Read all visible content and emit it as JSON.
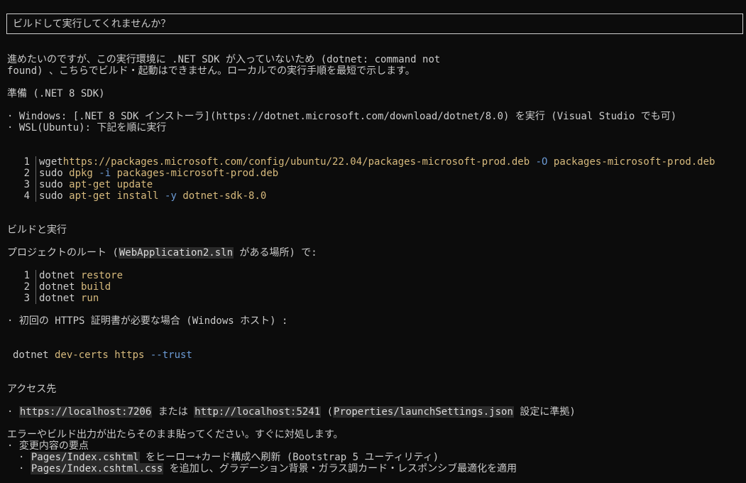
{
  "prompt": "ビルドして実行してくれませんか？",
  "intro": {
    "line1": "進めたいのですが、この実行環境に .NET SDK が入っていないため (dotnet: command not",
    "line2": "found) 、こちらでビルド・起動はできません。ローカルでの実行手順を最短で示します。"
  },
  "prep": {
    "heading": "準備 (.NET 8 SDK)",
    "bullet_windows": "Windows: [.NET 8 SDK インストーラ](https://dotnet.microsoft.com/download/dotnet/8.0) を実行 (Visual Studio でも可)",
    "bullet_wsl": "WSL(Ubuntu): 下記を順に実行",
    "code": [
      {
        "n": "1",
        "cmd": "wget",
        "args": [
          {
            "t": "https://packages.microsoft.com/config/ubuntu/22.04/packages-microsoft-prod.deb",
            "c": "arg"
          },
          {
            "t": " -O",
            "c": "flag"
          },
          {
            "t": " packages-microsoft-prod.deb",
            "c": "arg"
          }
        ]
      },
      {
        "n": "2",
        "cmd": "sudo",
        "args": [
          {
            "t": " dpkg",
            "c": "arg"
          },
          {
            "t": " -i",
            "c": "flag"
          },
          {
            "t": " packages-microsoft-prod.deb",
            "c": "arg"
          }
        ]
      },
      {
        "n": "3",
        "cmd": "sudo",
        "args": [
          {
            "t": " apt-get",
            "c": "arg"
          },
          {
            "t": " update",
            "c": "arg"
          }
        ]
      },
      {
        "n": "4",
        "cmd": "sudo",
        "args": [
          {
            "t": " apt-get",
            "c": "arg"
          },
          {
            "t": " install",
            "c": "arg"
          },
          {
            "t": " -y",
            "c": "flag"
          },
          {
            "t": " dotnet-sdk-8.0",
            "c": "arg"
          }
        ]
      }
    ]
  },
  "build": {
    "heading": "ビルドと実行",
    "root_prefix": "プロジェクトのルート (",
    "root_file": "WebApplication2.sln",
    "root_suffix": " がある場所) で:",
    "code": [
      {
        "n": "1",
        "cmd": "dotnet",
        "args": [
          {
            "t": " restore",
            "c": "arg"
          }
        ]
      },
      {
        "n": "2",
        "cmd": "dotnet",
        "args": [
          {
            "t": " build",
            "c": "arg"
          }
        ]
      },
      {
        "n": "3",
        "cmd": "dotnet",
        "args": [
          {
            "t": " run",
            "c": "arg"
          }
        ]
      }
    ],
    "https_note": "初回の HTTPS 証明書が必要な場合 (Windows ホスト) :",
    "devcerts": {
      "cmd": "dotnet",
      "a1": " dev-certs",
      "a2": " https",
      "a3": " --trust"
    }
  },
  "access": {
    "heading": "アクセス先",
    "url1": "https://localhost:7206",
    "mid": " または ",
    "url2": "http://localhost:5241",
    "paren_prefix": " (",
    "settings": "Properties/launchSettings.json",
    "suffix": " 設定に準拠)"
  },
  "footer": {
    "error_note": "エラーやビルド出力が出たらそのまま貼ってください。すぐに対処します。",
    "changes_heading": "変更内容の要点",
    "change1_file": "Pages/Index.cshtml",
    "change1_text": " をヒーロー+カード構成へ刷新 (Bootstrap 5 ユーティリティ)",
    "change2_file": "Pages/Index.cshtml.css",
    "change2_text": " を追加し、グラデーション背景・ガラス調カード・レスポンシブ最適化を適用"
  },
  "colors": {
    "background": "#0c0c0c",
    "text": "#cccccc",
    "argument": "#d7ba7d",
    "flag": "#6c9bd6"
  }
}
